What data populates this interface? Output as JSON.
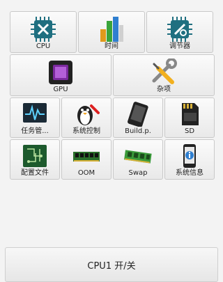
{
  "tiles_row1": [
    {
      "label": "CPU",
      "icon": "cpu-chip-wrench-icon"
    },
    {
      "label": "时间",
      "icon": "bar-chart-icon"
    },
    {
      "label": "调节器",
      "icon": "cpu-chip-settings-icon"
    }
  ],
  "tiles_row2": [
    {
      "label": "GPU",
      "icon": "gpu-chip-icon"
    },
    {
      "label": "杂项",
      "icon": "wrench-screwdriver-icon"
    }
  ],
  "tiles_row3": [
    {
      "label": "任务管...",
      "icon": "monitor-waveform-icon"
    },
    {
      "label": "系统控制",
      "icon": "penguin-icon"
    },
    {
      "label": "Build.p.",
      "icon": "phone-icon"
    },
    {
      "label": "SD",
      "icon": "sd-card-icon"
    }
  ],
  "tiles_row4": [
    {
      "label": "配置文件",
      "icon": "circuit-board-icon"
    },
    {
      "label": "OOM",
      "icon": "ram-module-icon"
    },
    {
      "label": "Swap",
      "icon": "ram-module-green-icon"
    },
    {
      "label": "系统信息",
      "icon": "phone-info-icon"
    }
  ],
  "bottom_button": {
    "label": "CPU1 开/关"
  },
  "colors": {
    "chip_teal": "#1f6f80",
    "accent_green": "#2d8a2d",
    "background": "#f3f3f3"
  }
}
